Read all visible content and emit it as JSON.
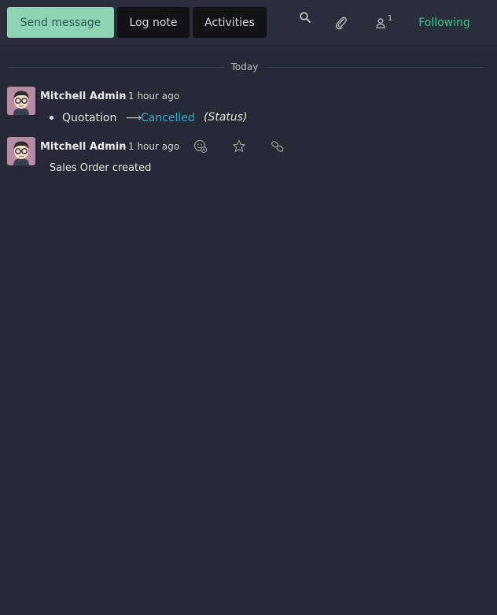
{
  "toolbar": {
    "send_message_label": "Send message",
    "log_note_label": "Log note",
    "activities_label": "Activities",
    "search_icon": "search-icon",
    "attachment_icon": "paperclip-icon",
    "followers_icon": "user-icon",
    "followers_count": "1",
    "following_label": "Following",
    "accent_color": "#35c48c"
  },
  "separator": {
    "label": "Today"
  },
  "messages": [
    {
      "author": "Mitchell Admin",
      "dash": "-",
      "time": "1 hour ago",
      "tracking": {
        "field": "Quotation",
        "arrow": "⟶",
        "new_value": "Cancelled",
        "field_name": "(Status)"
      }
    },
    {
      "author": "Mitchell Admin",
      "dash": "-",
      "time": "1 hour ago",
      "body": "Sales Order created",
      "actions": [
        "add-reaction-icon",
        "star-icon",
        "link-icon"
      ]
    }
  ]
}
